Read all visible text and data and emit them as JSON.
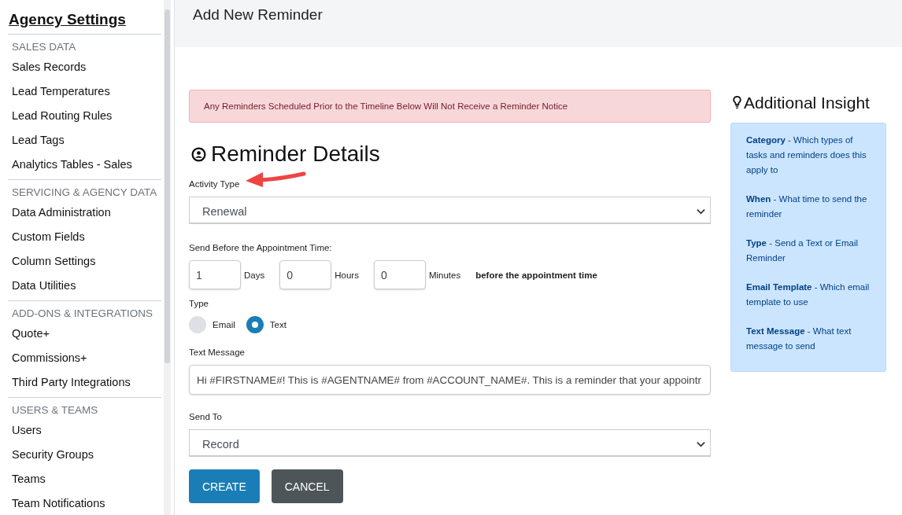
{
  "sidebar": {
    "title": "Agency Settings",
    "sections": [
      {
        "heading": "SALES DATA",
        "items": [
          {
            "label": "Sales Records"
          },
          {
            "label": "Lead Temperatures"
          },
          {
            "label": "Lead Routing Rules"
          },
          {
            "label": "Lead Tags"
          },
          {
            "label": "Analytics Tables - Sales"
          }
        ]
      },
      {
        "heading": "SERVICING & AGENCY DATA",
        "items": [
          {
            "label": "Data Administration"
          },
          {
            "label": "Custom Fields"
          },
          {
            "label": "Column Settings"
          },
          {
            "label": "Data Utilities"
          }
        ]
      },
      {
        "heading": "ADD-ONS & INTEGRATIONS",
        "items": [
          {
            "label": "Quote+"
          },
          {
            "label": "Commissions+"
          },
          {
            "label": "Third Party Integrations"
          }
        ]
      },
      {
        "heading": "USERS & TEAMS",
        "items": [
          {
            "label": "Users"
          },
          {
            "label": "Security Groups"
          },
          {
            "label": "Teams"
          },
          {
            "label": "Team Notifications"
          }
        ]
      }
    ]
  },
  "page_title": "Add New Reminder",
  "alert": "Any Reminders Scheduled Prior to the Timeline Below Will Not Receive a Reminder Notice",
  "form": {
    "title": "Reminder Details",
    "activity_type": {
      "label": "Activity Type",
      "value": "Renewal"
    },
    "send_before": {
      "label": "Send Before the Appointment Time:",
      "fields": [
        {
          "value": "1",
          "unit": "Days"
        },
        {
          "value": "0",
          "unit": "Hours"
        },
        {
          "value": "0",
          "unit": "Minutes"
        }
      ],
      "suffix": "before the appointment time"
    },
    "type": {
      "label": "Type",
      "options": [
        {
          "label": "Email",
          "selected": false
        },
        {
          "label": "Text",
          "selected": true
        }
      ]
    },
    "text_message": {
      "label": "Text Message",
      "value": "Hi #FIRSTNAME#! This is #AGENTNAME# from #ACCOUNT_NAME#. This is a reminder that your appointr"
    },
    "send_to": {
      "label": "Send To",
      "value": "Record"
    },
    "buttons": [
      {
        "label": "CREATE",
        "kind": "primary"
      },
      {
        "label": "CANCEL",
        "kind": "secondary"
      }
    ]
  },
  "insight": {
    "title": "Additional Insight",
    "items": [
      "**Category** - Which types of tasks and reminders does this apply to",
      "**When** - What time to send the reminder",
      "**Type** - Send a Text or Email Reminder",
      "**Email Template** - Which email template to use",
      "**Text Message** - What text message to send"
    ]
  }
}
